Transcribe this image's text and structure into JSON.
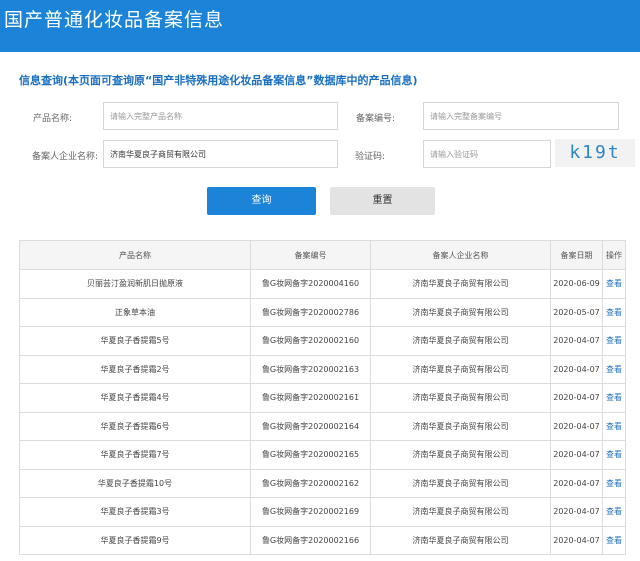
{
  "header": {
    "title": "国产普通化妆品备案信息"
  },
  "query": {
    "title": "信息查询(本页面可查询原“国产非特殊用途化妆品备案信息”数据库中的产品信息)",
    "product_name_label": "产品名称:",
    "product_name_placeholder": "请输入完整产品名称",
    "record_no_label": "备案编号:",
    "record_no_placeholder": "请输入完整备案编号",
    "company_label": "备案人企业名称:",
    "company_value": "济南华夏良子商贸有限公司",
    "captcha_label": "验证码:",
    "captcha_placeholder": "请输入验证码",
    "captcha_text": "k19t",
    "query_button": "查询",
    "reset_button": "重置"
  },
  "table": {
    "headers": [
      "产品名称",
      "备案编号",
      "备案人企业名称",
      "备案日期",
      "操作"
    ],
    "rows": [
      [
        "贝丽芸汀盈润新肌日抛原液",
        "鲁G妆网备字2020004160",
        "济南华夏良子商贸有限公司",
        "2020-06-09",
        "查看"
      ],
      [
        "正象草本油",
        "鲁G妆网备字2020002786",
        "济南华夏良子商贸有限公司",
        "2020-05-07",
        "查看"
      ],
      [
        "华夏良子香提霜5号",
        "鲁G妆网备字2020002160",
        "济南华夏良子商贸有限公司",
        "2020-04-07",
        "查看"
      ],
      [
        "华夏良子香提霜2号",
        "鲁G妆网备字2020002163",
        "济南华夏良子商贸有限公司",
        "2020-04-07",
        "查看"
      ],
      [
        "华夏良子香提霜4号",
        "鲁G妆网备字2020002161",
        "济南华夏良子商贸有限公司",
        "2020-04-07",
        "查看"
      ],
      [
        "华夏良子香提霜6号",
        "鲁G妆网备字2020002164",
        "济南华夏良子商贸有限公司",
        "2020-04-07",
        "查看"
      ],
      [
        "华夏良子香提霜7号",
        "鲁G妆网备字2020002165",
        "济南华夏良子商贸有限公司",
        "2020-04-07",
        "查看"
      ],
      [
        "华夏良子香提霜10号",
        "鲁G妆网备字2020002162",
        "济南华夏良子商贸有限公司",
        "2020-04-07",
        "查看"
      ],
      [
        "华夏良子香提霜3号",
        "鲁G妆网备字2020002169",
        "济南华夏良子商贸有限公司",
        "2020-04-07",
        "查看"
      ],
      [
        "华夏良子香提霜9号",
        "鲁G妆网备字2020002166",
        "济南华夏良子商贸有限公司",
        "2020-04-07",
        "查看"
      ]
    ]
  },
  "colors": {
    "accent": "#1b84d8",
    "link": "#1b6fbf"
  }
}
